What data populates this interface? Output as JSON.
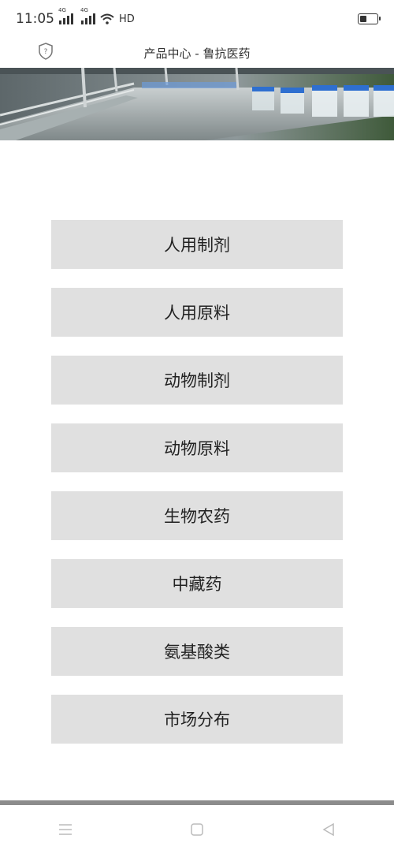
{
  "status_bar": {
    "time": "11:05",
    "network_1": "4G",
    "network_2": "4G",
    "hd": "HD"
  },
  "header": {
    "title": "产品中心 - 鲁抗医药"
  },
  "menu": {
    "items": [
      {
        "label": "人用制剂"
      },
      {
        "label": "人用原料"
      },
      {
        "label": "动物制剂"
      },
      {
        "label": "动物原料"
      },
      {
        "label": "生物农药"
      },
      {
        "label": "中藏药"
      },
      {
        "label": "氨基酸类"
      },
      {
        "label": "市场分布"
      }
    ]
  },
  "icons": {
    "shield": "shield-icon",
    "wifi": "wifi-icon",
    "battery": "battery-icon",
    "nav_menu": "menu-icon",
    "nav_home": "square-icon",
    "nav_back": "back-icon"
  }
}
